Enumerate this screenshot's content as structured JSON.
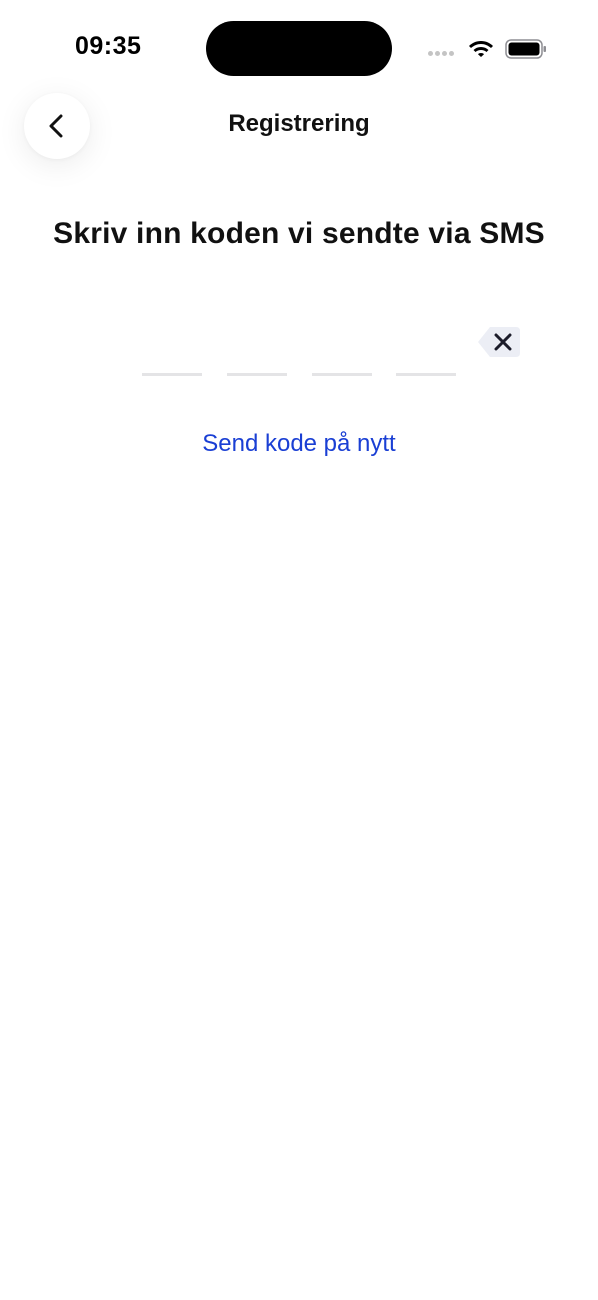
{
  "status_bar": {
    "time": "09:35",
    "icons": [
      "signal-icon",
      "wifi-icon",
      "battery-icon"
    ]
  },
  "header": {
    "title": "Registrering",
    "back_icon": "chevron-left-icon"
  },
  "main": {
    "heading": "Skriv inn koden vi sendte via SMS",
    "code": {
      "digits": [
        "",
        "",
        "",
        ""
      ],
      "delete_icon": "backspace-icon"
    },
    "resend_label": "Send kode på nytt"
  },
  "colors": {
    "link": "#1a3fd4",
    "text": "#111111",
    "slot_underline": "#e4e4e6",
    "delete_key_bg": "#eceef5"
  }
}
